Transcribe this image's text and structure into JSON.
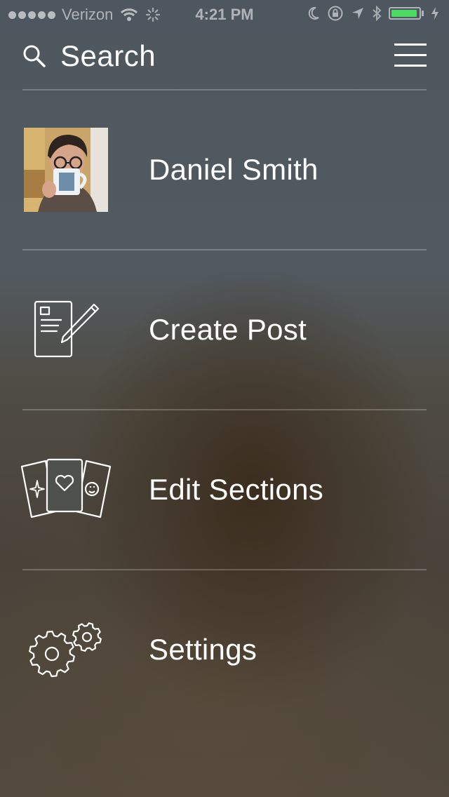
{
  "status_bar": {
    "carrier": "Verizon",
    "time": "4:21 PM",
    "signal_bars": 5,
    "battery_level": 0.95,
    "battery_color": "#4cd964",
    "icons": [
      "wifi-icon",
      "activity-spinner-icon",
      "moon-icon",
      "orientation-lock-icon",
      "location-arrow-icon",
      "bluetooth-icon",
      "battery-icon",
      "charging-bolt-icon"
    ]
  },
  "header": {
    "search_label": "Search",
    "search_icon": "search-icon",
    "menu_icon": "hamburger-menu-icon"
  },
  "menu": {
    "items": [
      {
        "label": "Daniel Smith",
        "icon": "profile-avatar"
      },
      {
        "label": "Create Post",
        "icon": "compose-post-icon"
      },
      {
        "label": "Edit Sections",
        "icon": "section-cards-icon"
      },
      {
        "label": "Settings",
        "icon": "gears-icon"
      }
    ]
  },
  "colors": {
    "text": "#ffffff",
    "divider": "rgba(255,255,255,0.22)"
  }
}
